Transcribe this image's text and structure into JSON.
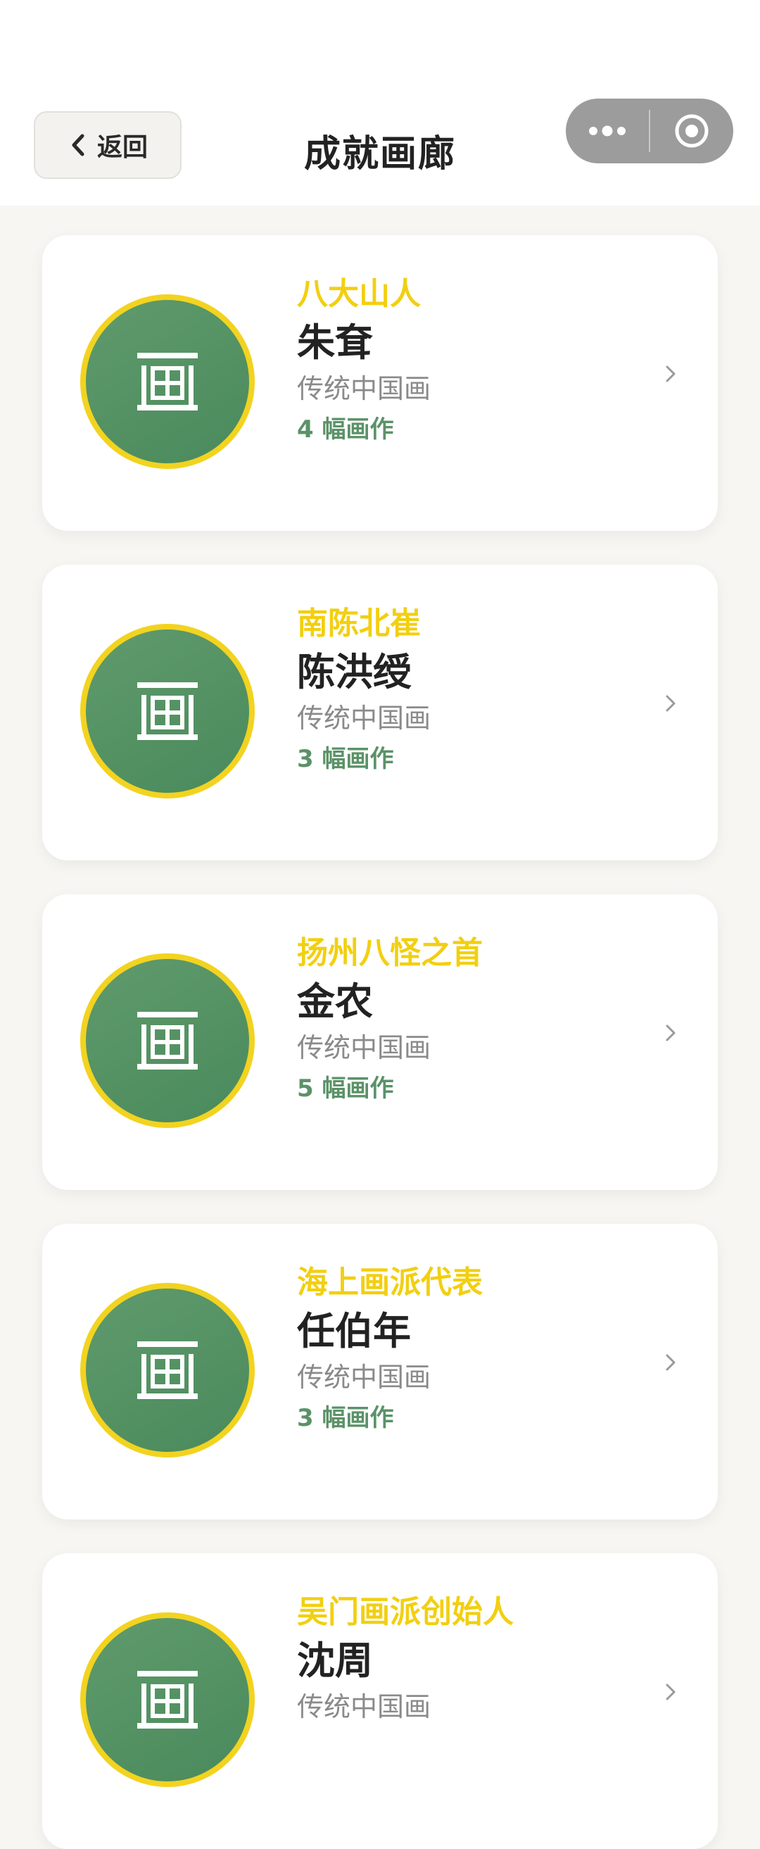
{
  "header": {
    "back_label": "返回",
    "title": "成就画廊",
    "capsule_icons": [
      "more-dots-icon",
      "close-target-icon"
    ]
  },
  "colors": {
    "accent_yellow": "#f2cf10",
    "avatar_green": "#4f8d5f",
    "count_green": "#5b9268",
    "background": "#f7f6f2"
  },
  "avatar_glyph": "画",
  "painters": [
    {
      "tag": "八大山人",
      "name": "朱耷",
      "genre": "传统中国画",
      "count": "4 幅画作"
    },
    {
      "tag": "南陈北崔",
      "name": "陈洪绶",
      "genre": "传统中国画",
      "count": "3 幅画作"
    },
    {
      "tag": "扬州八怪之首",
      "name": "金农",
      "genre": "传统中国画",
      "count": "5 幅画作"
    },
    {
      "tag": "海上画派代表",
      "name": "任伯年",
      "genre": "传统中国画",
      "count": "3 幅画作"
    },
    {
      "tag": "吴门画派创始人",
      "name": "沈周",
      "genre": "传统中国画",
      "count": ""
    }
  ]
}
